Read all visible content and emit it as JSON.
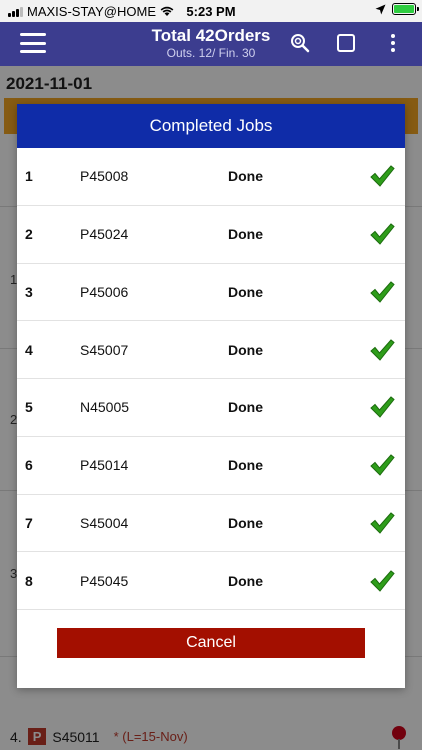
{
  "status_bar": {
    "carrier": "MAXIS-STAY@HOME",
    "time": "5:23 PM"
  },
  "header": {
    "title": "Total 42Orders",
    "subtitle": "Outs. 12/ Fin. 30"
  },
  "background": {
    "date": "2021-11-01",
    "row_numbers": [
      "1",
      "2",
      "3"
    ],
    "bottom_item": {
      "index": "4.",
      "badge": "P",
      "code": "S45011",
      "note": "* (L=15-Nov)"
    }
  },
  "dialog": {
    "title": "Completed Jobs",
    "jobs": [
      {
        "num": "1",
        "code": "P45008",
        "status": "Done"
      },
      {
        "num": "2",
        "code": "P45024",
        "status": "Done"
      },
      {
        "num": "3",
        "code": "P45006",
        "status": "Done"
      },
      {
        "num": "4",
        "code": "S45007",
        "status": "Done"
      },
      {
        "num": "5",
        "code": "N45005",
        "status": "Done"
      },
      {
        "num": "6",
        "code": "P45014",
        "status": "Done"
      },
      {
        "num": "7",
        "code": "S45004",
        "status": "Done"
      },
      {
        "num": "8",
        "code": "P45045",
        "status": "Done"
      }
    ],
    "cancel_label": "Cancel"
  },
  "colors": {
    "appbar": "#3c3d8f",
    "dialog_header": "#0f2ca8",
    "cancel": "#a30f00",
    "check": "#2e9d1a"
  }
}
